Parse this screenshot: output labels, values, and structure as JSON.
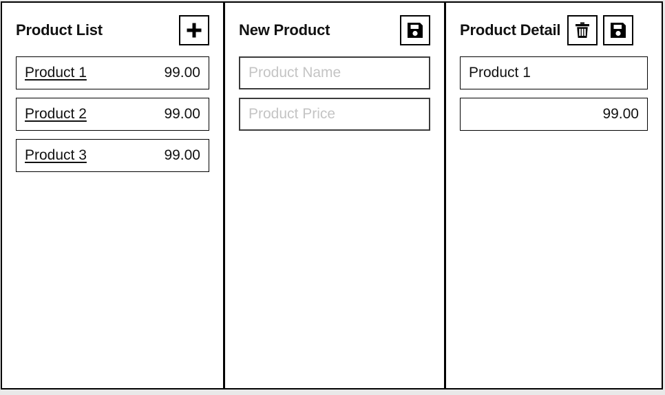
{
  "colors": {
    "border": "#000000",
    "text": "#111111",
    "placeholder": "#c4c4c4",
    "background": "#ffffff",
    "page_background": "#e9e9e9"
  },
  "panels": {
    "list": {
      "title": "Product List",
      "add_button": {
        "icon": "plus-icon",
        "label": "+"
      },
      "items": [
        {
          "name": "Product 1",
          "price": "99.00"
        },
        {
          "name": "Product 2",
          "price": "99.00"
        },
        {
          "name": "Product 3",
          "price": "99.00"
        }
      ]
    },
    "new_product": {
      "title": "New Product",
      "save_button": {
        "icon": "save-floppy-icon"
      },
      "fields": {
        "name": {
          "value": "",
          "placeholder": "Product Name"
        },
        "price": {
          "value": "",
          "placeholder": "Product Price"
        }
      }
    },
    "detail": {
      "title": "Product Detail",
      "delete_button": {
        "icon": "trash-icon"
      },
      "save_button": {
        "icon": "save-floppy-icon"
      },
      "fields": {
        "name": {
          "value": "Product 1",
          "placeholder": ""
        },
        "price": {
          "value": "99.00",
          "placeholder": ""
        }
      }
    }
  }
}
